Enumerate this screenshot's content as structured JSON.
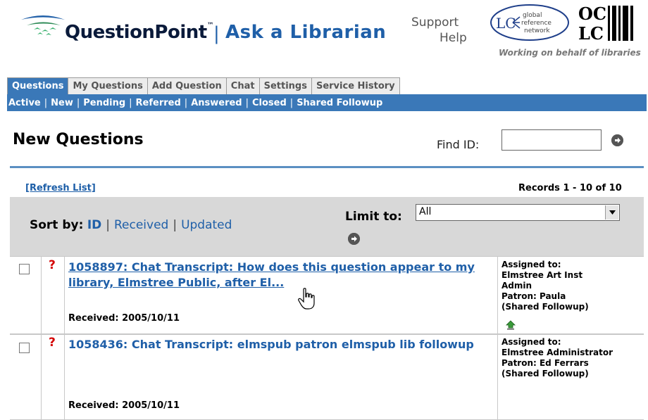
{
  "header": {
    "brand": "QuestionPoint",
    "brand_tm": "™",
    "separator": "|",
    "tagline": "Ask a Librarian",
    "support": "Support",
    "help": "Help",
    "lc_logo_text": {
      "main": "LC",
      "line1": "global",
      "line2": "reference",
      "line3": "network"
    },
    "oclc_text": "OC LC",
    "oclc_tagline": "Working on behalf of libraries"
  },
  "tabs": [
    {
      "label": "Questions",
      "active": true
    },
    {
      "label": "My Questions",
      "active": false
    },
    {
      "label": "Add Question",
      "active": false
    },
    {
      "label": "Chat",
      "active": false
    },
    {
      "label": "Settings",
      "active": false
    },
    {
      "label": "Service History",
      "active": false
    }
  ],
  "subnav": [
    "Active",
    "New",
    "Pending",
    "Referred",
    "Answered",
    "Closed",
    "Shared Followup"
  ],
  "main": {
    "title": "New Questions",
    "find_label": "Find ID:",
    "find_value": "",
    "refresh": "[Refresh List]",
    "records": "Records 1 - 10 of 10"
  },
  "toolbar": {
    "sort_label": "Sort by:",
    "sort_options": [
      "ID",
      "Received",
      "Updated"
    ],
    "sort_separator": "|",
    "limit_label": "Limit to:",
    "limit_value": "All"
  },
  "questions": [
    {
      "flag": "?",
      "title": "1058897: Chat Transcript: How does this question appear to my library, Elmstree Public, after El...",
      "received": "Received: 2005/10/11",
      "assigned_label": "Assigned to:",
      "assigned_to": "Elmstree Art Inst Admin",
      "patron": "Patron: Paula",
      "shared": "(Shared Followup)"
    },
    {
      "flag": "?",
      "title": "1058436: Chat Transcript: elmspub patron elmspub lib followup",
      "received": "Received: 2005/10/11",
      "assigned_label": "Assigned to:",
      "assigned_to": "Elmstree Administrator",
      "patron": "Patron: Ed Ferrars",
      "shared": "(Shared Followup)"
    }
  ],
  "colors": {
    "accent": "#3a78b8",
    "link": "#1f5fa8",
    "flag": "#d40000",
    "toolbar": "#d8d8d8"
  }
}
